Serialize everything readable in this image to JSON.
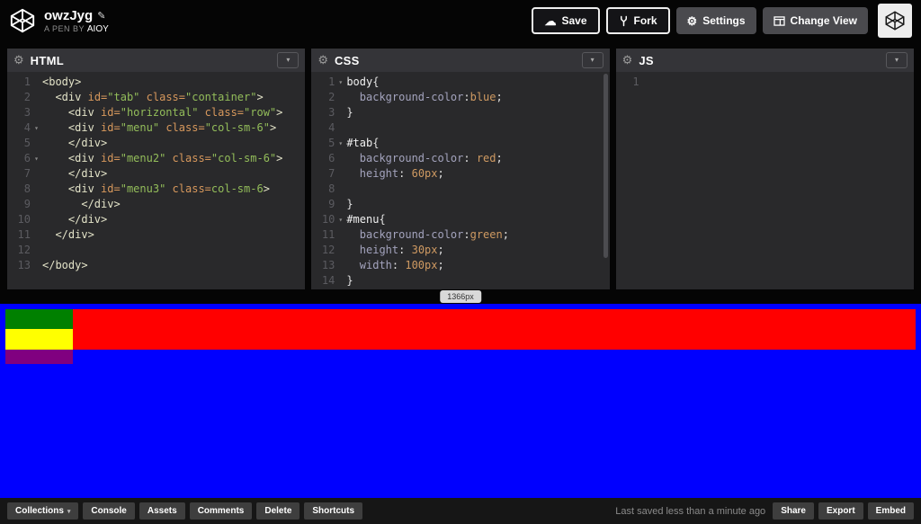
{
  "header": {
    "title": "owzJyg",
    "byline_prefix": "A PEN BY",
    "author": "Aioy",
    "save_label": "Save",
    "fork_label": "Fork",
    "settings_label": "Settings",
    "change_view_label": "Change View"
  },
  "editors": [
    {
      "name": "HTML",
      "lines": [
        {
          "n": "1",
          "t": [
            [
              "tag",
              "<body>"
            ]
          ]
        },
        {
          "n": "2",
          "t": [
            [
              "pl",
              "  "
            ],
            [
              "tag",
              "<div"
            ],
            [
              "pl",
              " "
            ],
            [
              "attr",
              "id="
            ],
            [
              "str",
              "\"tab\""
            ],
            [
              "pl",
              " "
            ],
            [
              "attr",
              "class="
            ],
            [
              "str",
              "\"container\""
            ],
            [
              "tag",
              ">"
            ]
          ]
        },
        {
          "n": "3",
          "t": [
            [
              "pl",
              "    "
            ],
            [
              "tag",
              "<div"
            ],
            [
              "pl",
              " "
            ],
            [
              "attr",
              "id="
            ],
            [
              "str",
              "\"horizontal\""
            ],
            [
              "pl",
              " "
            ],
            [
              "attr",
              "class="
            ],
            [
              "str",
              "\"row\""
            ],
            [
              "tag",
              ">"
            ]
          ]
        },
        {
          "n": "4",
          "fold": true,
          "t": [
            [
              "pl",
              "    "
            ],
            [
              "tag",
              "<div"
            ],
            [
              "pl",
              " "
            ],
            [
              "attr",
              "id="
            ],
            [
              "str",
              "\"menu\""
            ],
            [
              "pl",
              " "
            ],
            [
              "attr",
              "class="
            ],
            [
              "str",
              "\"col-sm-6\""
            ],
            [
              "tag",
              ">"
            ]
          ]
        },
        {
          "n": "5",
          "t": [
            [
              "pl",
              "    "
            ],
            [
              "tag",
              "</div>"
            ]
          ]
        },
        {
          "n": "6",
          "fold": true,
          "t": [
            [
              "pl",
              "    "
            ],
            [
              "tag",
              "<div"
            ],
            [
              "pl",
              " "
            ],
            [
              "attr",
              "id="
            ],
            [
              "str",
              "\"menu2\""
            ],
            [
              "pl",
              " "
            ],
            [
              "attr",
              "class="
            ],
            [
              "str",
              "\"col-sm-6\""
            ],
            [
              "tag",
              ">"
            ]
          ]
        },
        {
          "n": "7",
          "t": [
            [
              "pl",
              "    "
            ],
            [
              "tag",
              "</div>"
            ]
          ]
        },
        {
          "n": "8",
          "t": [
            [
              "pl",
              "    "
            ],
            [
              "tag",
              "<div"
            ],
            [
              "pl",
              " "
            ],
            [
              "attr",
              "id="
            ],
            [
              "str",
              "\"menu3\""
            ],
            [
              "pl",
              " "
            ],
            [
              "attr",
              "class="
            ],
            [
              "str",
              "col-sm-6"
            ],
            [
              "tag",
              ">"
            ]
          ]
        },
        {
          "n": "9",
          "t": [
            [
              "pl",
              "      "
            ],
            [
              "tag",
              "</div>"
            ]
          ]
        },
        {
          "n": "10",
          "t": [
            [
              "pl",
              "    "
            ],
            [
              "tag",
              "</div>"
            ]
          ]
        },
        {
          "n": "11",
          "t": [
            [
              "pl",
              "  "
            ],
            [
              "tag",
              "</div>"
            ]
          ]
        },
        {
          "n": "12",
          "t": []
        },
        {
          "n": "13",
          "t": [
            [
              "tag",
              "</body>"
            ]
          ]
        }
      ]
    },
    {
      "name": "CSS",
      "scrollbar": true,
      "lines": [
        {
          "n": "1",
          "fold": true,
          "t": [
            [
              "sel",
              "body"
            ],
            [
              "pun",
              "{"
            ]
          ]
        },
        {
          "n": "2",
          "t": [
            [
              "pl",
              "  "
            ],
            [
              "prop",
              "background-color"
            ],
            [
              "pun",
              ":"
            ],
            [
              "val",
              "blue"
            ],
            [
              "pun",
              ";"
            ]
          ]
        },
        {
          "n": "3",
          "t": [
            [
              "pun",
              "}"
            ]
          ]
        },
        {
          "n": "4",
          "t": []
        },
        {
          "n": "5",
          "fold": true,
          "t": [
            [
              "sel",
              "#tab"
            ],
            [
              "pun",
              "{"
            ]
          ]
        },
        {
          "n": "6",
          "t": [
            [
              "pl",
              "  "
            ],
            [
              "prop",
              "background-color"
            ],
            [
              "pun",
              ": "
            ],
            [
              "val",
              "red"
            ],
            [
              "pun",
              ";"
            ]
          ]
        },
        {
          "n": "7",
          "t": [
            [
              "pl",
              "  "
            ],
            [
              "prop",
              "height"
            ],
            [
              "pun",
              ": "
            ],
            [
              "num",
              "60px"
            ],
            [
              "pun",
              ";"
            ]
          ]
        },
        {
          "n": "8",
          "t": []
        },
        {
          "n": "9",
          "t": [
            [
              "pun",
              "}"
            ]
          ]
        },
        {
          "n": "10",
          "fold": true,
          "t": [
            [
              "sel",
              "#menu"
            ],
            [
              "pun",
              "{"
            ]
          ]
        },
        {
          "n": "11",
          "t": [
            [
              "pl",
              "  "
            ],
            [
              "prop",
              "background-color"
            ],
            [
              "pun",
              ":"
            ],
            [
              "val",
              "green"
            ],
            [
              "pun",
              ";"
            ]
          ]
        },
        {
          "n": "12",
          "t": [
            [
              "pl",
              "  "
            ],
            [
              "prop",
              "height"
            ],
            [
              "pun",
              ": "
            ],
            [
              "num",
              "30px"
            ],
            [
              "pun",
              ";"
            ]
          ]
        },
        {
          "n": "13",
          "t": [
            [
              "pl",
              "  "
            ],
            [
              "prop",
              "width"
            ],
            [
              "pun",
              ": "
            ],
            [
              "num",
              "100px"
            ],
            [
              "pun",
              ";"
            ]
          ]
        },
        {
          "n": "14",
          "t": [
            [
              "pun",
              "}"
            ]
          ]
        }
      ]
    },
    {
      "name": "JS",
      "lines": [
        {
          "n": "1",
          "t": []
        }
      ]
    }
  ],
  "preview": {
    "width_badge": "1366px",
    "body_color": "#0000ff",
    "tab_color": "#ff0000",
    "menu_colors": [
      "#008000",
      "#ffff00",
      "#800080"
    ]
  },
  "footer": {
    "buttons_left": [
      {
        "label": "Collections",
        "dropdown": true
      },
      {
        "label": "Console"
      },
      {
        "label": "Assets"
      },
      {
        "label": "Comments"
      },
      {
        "label": "Delete"
      },
      {
        "label": "Shortcuts"
      }
    ],
    "status": "Last saved less than a minute ago",
    "buttons_right": [
      "Share",
      "Export",
      "Embed"
    ]
  }
}
